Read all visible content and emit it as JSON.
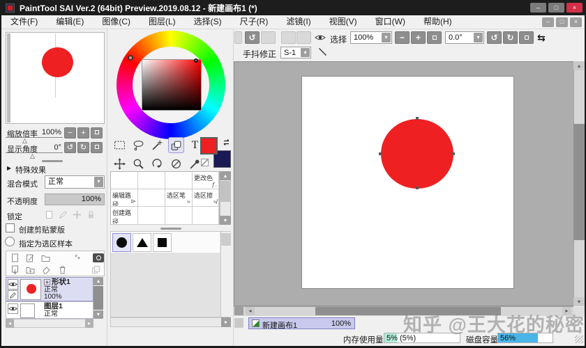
{
  "window": {
    "title": "PaintTool SAI Ver.2 (64bit) Preview.2019.08.12 - 新建画布1 (*)"
  },
  "menu": {
    "items": [
      "文件(F)",
      "编辑(E)",
      "图像(C)",
      "图层(L)",
      "选择(S)",
      "尺子(R)",
      "滤镜(I)",
      "视图(V)",
      "窗口(W)",
      "帮助(H)"
    ]
  },
  "icons": {
    "minus": "−",
    "plus": "+",
    "undo": "↺",
    "rotate_ccw": "↺",
    "rotate_cw": "↻",
    "flip": "⇆",
    "dropdown": "▾",
    "scroll_up": "▴",
    "scroll_down": "▾",
    "scroll_left": "◂",
    "scroll_right": "▸",
    "collapse": "▶",
    "slider_marker": "△",
    "backslash": "\\",
    "text_tool": "T",
    "fx": "ƒ.",
    "path_cursor": "⊳",
    "pen_scribble": "≈",
    "eraser_scribble": "≉",
    "star": "*",
    "down_arrow": "↓",
    "win_min": "–",
    "win_max": "□",
    "win_close": "×",
    "mdi_min": "–",
    "mdi_max": "□",
    "mdi_close": "×"
  },
  "left_panel": {
    "zoom_label": "缩放倍率",
    "zoom_value": "100%",
    "angle_label": "显示角度",
    "angle_value": "0°",
    "special_effects_label": "特殊效果",
    "blend_label": "混合模式",
    "blend_value": "正常",
    "opacity_label": "不透明度",
    "opacity_value": "100%",
    "lock_label": "锁定",
    "clip_mask_label": "创建剪贴蒙版",
    "sel_sample_label": "指定为选区样本",
    "layers": [
      {
        "name": "形状1",
        "mode": "正常",
        "opacity": "100%"
      },
      {
        "name": "图层1",
        "mode": "正常"
      }
    ]
  },
  "tool_panel": {
    "fg_color": "#ee2022",
    "bg_color": "#191955",
    "list": {
      "change_color": "更改色",
      "edit_path": "编辑路径",
      "sel_pen": "选区笔",
      "sel_eraser": "选区擦",
      "create_path": "创建路径"
    },
    "shapes": [
      "circle",
      "triangle",
      "square"
    ]
  },
  "canvas_toolbar": {
    "select_label": "选择",
    "zoom_value": "100%",
    "angle_value": "0.0°",
    "stabilizer_label": "手抖修正",
    "stabilizer_value": "S-1"
  },
  "document": {
    "tab_title": "新建画布1",
    "tab_zoom": "100%"
  },
  "status": {
    "memory_label": "内存使用量",
    "memory_value": "5% (5%)",
    "memory_fill": "width:17%",
    "disk_label": "磁盘容量",
    "disk_value": "56%",
    "disk_fill": "width:73%"
  },
  "watermark": "知乎 @王大花的秘密"
}
